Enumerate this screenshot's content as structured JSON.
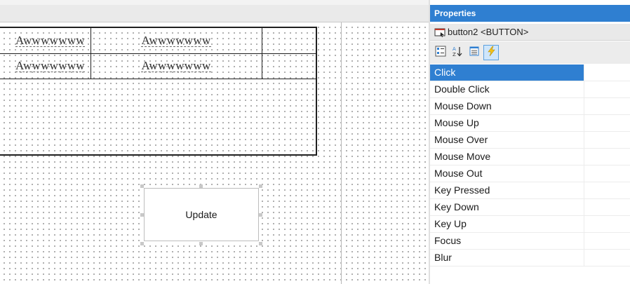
{
  "designer": {
    "table_rows": [
      {
        "cells": [
          "Awwwwwww",
          "Awwwwwww",
          ""
        ]
      },
      {
        "cells": [
          "Awwwwwww",
          "Awwwwwww",
          ""
        ]
      }
    ],
    "button_label": "Update"
  },
  "properties": {
    "title": "Properties",
    "selected_object": "button2 <BUTTON>",
    "toolbar": [
      {
        "name": "categorized-icon",
        "active": false
      },
      {
        "name": "sort-alpha-icon",
        "active": false
      },
      {
        "name": "property-pages-icon",
        "active": false
      },
      {
        "name": "events-lightning-icon",
        "active": true
      }
    ],
    "events": [
      {
        "label": "Click",
        "selected": true
      },
      {
        "label": "Double Click"
      },
      {
        "label": "Mouse Down"
      },
      {
        "label": "Mouse Up"
      },
      {
        "label": "Mouse Over"
      },
      {
        "label": "Mouse Move"
      },
      {
        "label": "Mouse Out"
      },
      {
        "label": "Key Pressed"
      },
      {
        "label": "Key Down"
      },
      {
        "label": "Key Up"
      },
      {
        "label": "Focus"
      },
      {
        "label": "Blur"
      }
    ],
    "accent_color": "#2f7fd1"
  }
}
